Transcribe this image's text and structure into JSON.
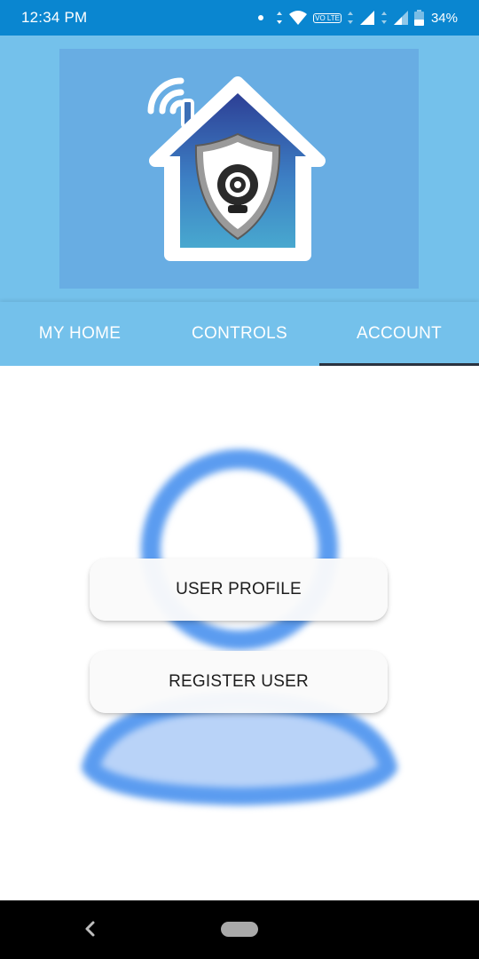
{
  "status_bar": {
    "time": "12:34 PM",
    "volte_label": "VO LTE",
    "battery_percent": "34%",
    "icons": [
      "notification-dot-icon",
      "data-arrows-icon",
      "wifi-icon",
      "volte-icon",
      "signal-icon",
      "battery-icon"
    ]
  },
  "header": {
    "logo_icons": [
      "house-icon",
      "wifi-signal-icon",
      "shield-icon",
      "webcam-icon"
    ]
  },
  "tabs": [
    {
      "label": "MY HOME"
    },
    {
      "label": "CONTROLS"
    },
    {
      "label": "ACCOUNT",
      "active": true
    }
  ],
  "main": {
    "background_icon": "user-silhouette-icon",
    "user_profile_label": "USER PROFILE",
    "register_user_label": "REGISTER USER"
  },
  "nav_bar": {
    "icons": [
      "back-icon",
      "home-pill-icon"
    ]
  },
  "colors": {
    "status_bar": "#0a86d0",
    "header": "#74c1eb",
    "logo_background": "#68ade3",
    "tab_indicator": "#2b3340",
    "silhouette": "#5b9cf0"
  }
}
